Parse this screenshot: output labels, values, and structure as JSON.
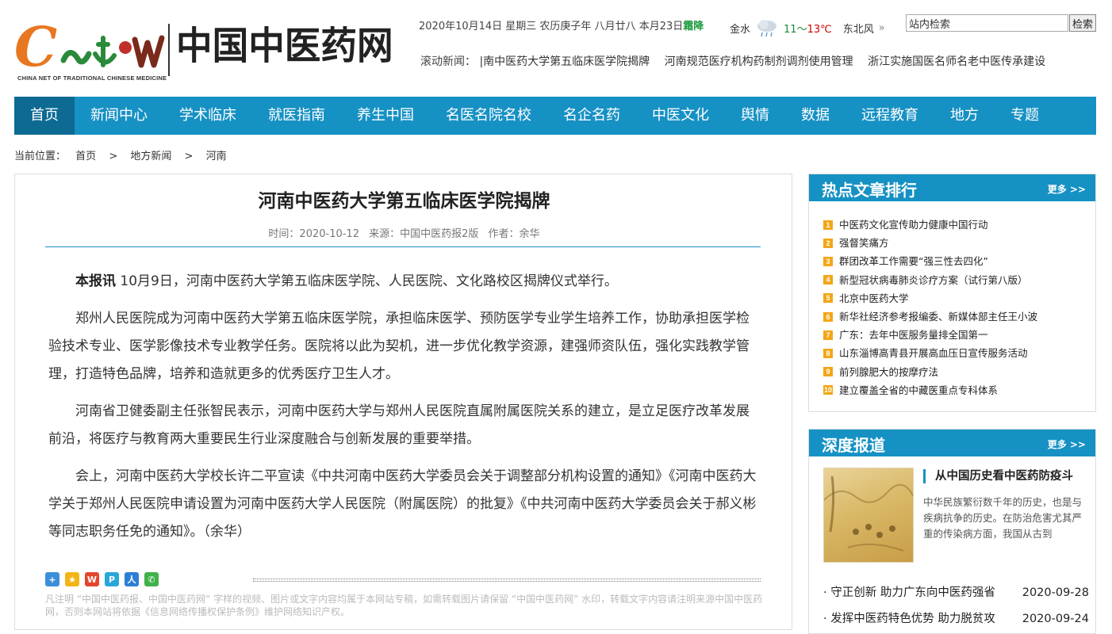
{
  "header": {
    "logo_en": "CHINA NET OF TRADITIONAL CHINESE MEDICINE",
    "logo_cn": "中国中医药网",
    "date_text": "2020年10月14日 星期三 农历庚子年 八月廿八 本月23日",
    "season_term": "霜降",
    "weather": {
      "city": "金水",
      "temp_low": "11",
      "tilde": "～",
      "temp_high": "13℃",
      "wind": "东北风",
      "more_glyph": "»"
    },
    "search": {
      "placeholder": "站内检索",
      "value": "站内检索",
      "button": "检索"
    },
    "scroll_news": {
      "label": "滚动新闻：",
      "items": [
        "|南中医药大学第五临床医学院揭牌",
        "河南规范医疗机构药制剂调剂使用管理",
        "浙江实施国医名师名老中医传承建设"
      ]
    }
  },
  "nav": {
    "items": [
      "首页",
      "新闻中心",
      "学术临床",
      "就医指南",
      "养生中国",
      "名医名院名校",
      "名企名药",
      "中医文化",
      "舆情",
      "数据",
      "远程教育",
      "地方",
      "专题"
    ]
  },
  "breadcrumb": {
    "label": "当前位置：",
    "items": [
      "首页",
      "地方新闻",
      "河南"
    ],
    "sep": ">"
  },
  "article": {
    "title": "河南中医药大学第五临床医学院揭牌",
    "meta": {
      "time": "时间：2020-10-12",
      "source": "来源：中国中医药报2版",
      "author": "作者：余华"
    },
    "lead_label": "本报讯",
    "paragraphs": [
      " 10月9日，河南中医药大学第五临床医学院、人民医院、文化路校区揭牌仪式举行。",
      "郑州人民医院成为河南中医药大学第五临床医学院，承担临床医学、预防医学专业学生培养工作，协助承担医学检验技术专业、医学影像技术专业教学任务。医院将以此为契机，进一步优化教学资源，建强师资队伍，强化实践教学管理，打造特色品牌，培养和造就更多的优秀医疗卫生人才。",
      "河南省卫健委副主任张智民表示，河南中医药大学与郑州人民医院直属附属医院关系的建立，是立足医疗改革发展前沿，将医疗与教育两大重要民生行业深度融合与创新发展的重要举措。",
      "会上，河南中医药大学校长许二平宣读《中共河南中医药大学委员会关于调整部分机构设置的通知》《河南中医药大学关于郑州人民医院申请设置为河南中医药大学人民医院（附属医院）的批复》《中共河南中医药大学委员会关于郝义彬等同志职务任免的通知》。（余华）"
    ],
    "copyright": "凡注明 “中国中医药报、中国中医药网” 字样的视频、图片或文字内容均属于本网站专稿，如需转载图片请保留 “中国中医药网” 水印，转载文字内容请注明来源中国中医药网，否则本网站将依据《信息网络传播权保护条例》维护网络知识产权。"
  },
  "hot": {
    "title": "热点文章排行",
    "more": "更多 >>",
    "items": [
      "中医药文化宣传助力健康中国行动",
      "强督笑痛方",
      "群团改革工作需要“强三性去四化”",
      "新型冠状病毒肺炎诊疗方案（试行第八版）",
      "北京中医药大学",
      "新华社经济参考报编委、新媒体部主任王小波",
      "广东：去年中医服务量排全国第一",
      "山东淄博高青县开展高血压日宣传服务活动",
      "前列腺肥大的按摩疗法",
      "建立覆盖全省的中藏医重点专科体系"
    ]
  },
  "deep": {
    "title": "深度报道",
    "more": "更多 >>",
    "feature_title": "从中国历史看中医药防疫斗",
    "feature_summary": "中华民族繁衍数千年的历史，也是与疾病抗争的历史。在防治危害尤其严重的传染病方面，我国从古到",
    "items": [
      {
        "title": "守正创新 助力广东向中医药强省",
        "date": "2020-09-28"
      },
      {
        "title": "发挥中医药特色优势 助力脱贫攻",
        "date": "2020-09-24"
      }
    ]
  },
  "colors": {
    "primary": "#1691c4",
    "nav_active": "#0c6a93",
    "rank": "#f3a616",
    "logo_orange": "#e87722"
  }
}
